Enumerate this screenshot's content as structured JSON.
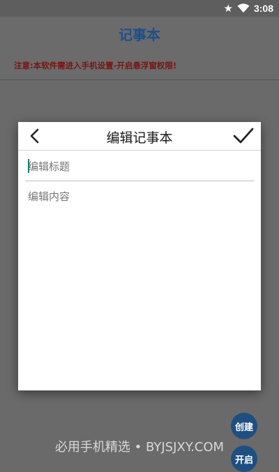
{
  "status_bar": {
    "star_icon": "★",
    "time": "3:08"
  },
  "app": {
    "title": "记事本",
    "notice": "注意:本软件需进入手机设置-开启悬浮窗权限!"
  },
  "dialog": {
    "title": "编辑记事本",
    "title_placeholder": "编辑标题",
    "content_placeholder": "编辑内容",
    "back_icon": "chevron-left-icon",
    "confirm_icon": "checkmark-icon"
  },
  "buttons": {
    "create_label": "创建",
    "open_label": "开启"
  },
  "watermark": "必用手机精选 • BYJSJXY.COM",
  "colors": {
    "overlay": "#6a6a6a",
    "accent": "#1e4f80",
    "notice": "#7a1414",
    "caret": "#1c7a6a"
  }
}
